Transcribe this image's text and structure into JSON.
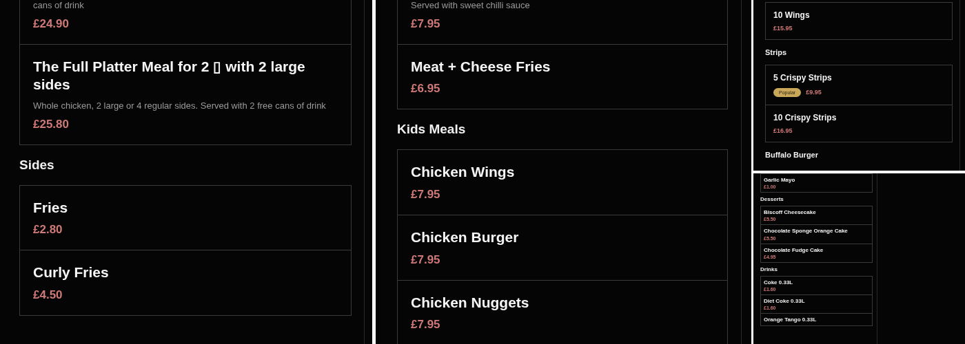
{
  "panels": [
    {
      "sections": [
        {
          "items": [
            {
              "description": "cans of drink",
              "price": "£24.90"
            },
            {
              "name": "The Full Platter Meal for 2 ▯ with 2 large sides",
              "description": "Whole chicken, 2 large or 4 regular sides. Served with 2 free cans of drink",
              "price": "£25.80"
            }
          ]
        },
        {
          "heading": "Sides",
          "items": [
            {
              "name": "Fries",
              "price": "£2.80"
            },
            {
              "name": "Curly Fries",
              "price": "£4.50"
            }
          ]
        }
      ]
    },
    {
      "sections": [
        {
          "items": [
            {
              "description": "Served with sweet chilli sauce",
              "price": "£7.95"
            },
            {
              "name": "Meat + Cheese Fries",
              "price": "£6.95"
            }
          ]
        },
        {
          "heading": "Kids Meals",
          "items": [
            {
              "name": "Chicken Wings",
              "price": "£7.95"
            },
            {
              "name": "Chicken Burger",
              "price": "£7.95"
            },
            {
              "name": "Chicken Nuggets",
              "price": "£7.95"
            }
          ]
        }
      ]
    },
    {
      "sections": [
        {
          "items": [
            {
              "name": "10 Wings",
              "price": "£15.95"
            }
          ]
        },
        {
          "heading": "Strips",
          "items": [
            {
              "name": "5 Crispy Strips",
              "badge": "Popular",
              "price": "£9.95"
            },
            {
              "name": "10 Crispy Strips",
              "price": "£16.95"
            }
          ]
        },
        {
          "heading": "Buffalo Burger"
        }
      ]
    },
    {
      "sections": [
        {
          "items": [
            {
              "name": "Garlic Mayo",
              "price": "£1.00"
            }
          ]
        },
        {
          "heading": "Desserts",
          "items": [
            {
              "name": "Biscoff Cheesecake",
              "price": "£5.50"
            },
            {
              "name": "Chocolate Sponge Orange Cake",
              "price": "£5.50"
            },
            {
              "name": "Chocolate Fudge Cake",
              "price": "£4.95"
            }
          ]
        },
        {
          "heading": "Drinks",
          "items": [
            {
              "name": "Coke 0.33L",
              "price": "£1.60"
            },
            {
              "name": "Diet Coke 0.33L",
              "price": "£1.60"
            },
            {
              "name": "Orange Tango 0.33L"
            }
          ]
        }
      ]
    }
  ]
}
